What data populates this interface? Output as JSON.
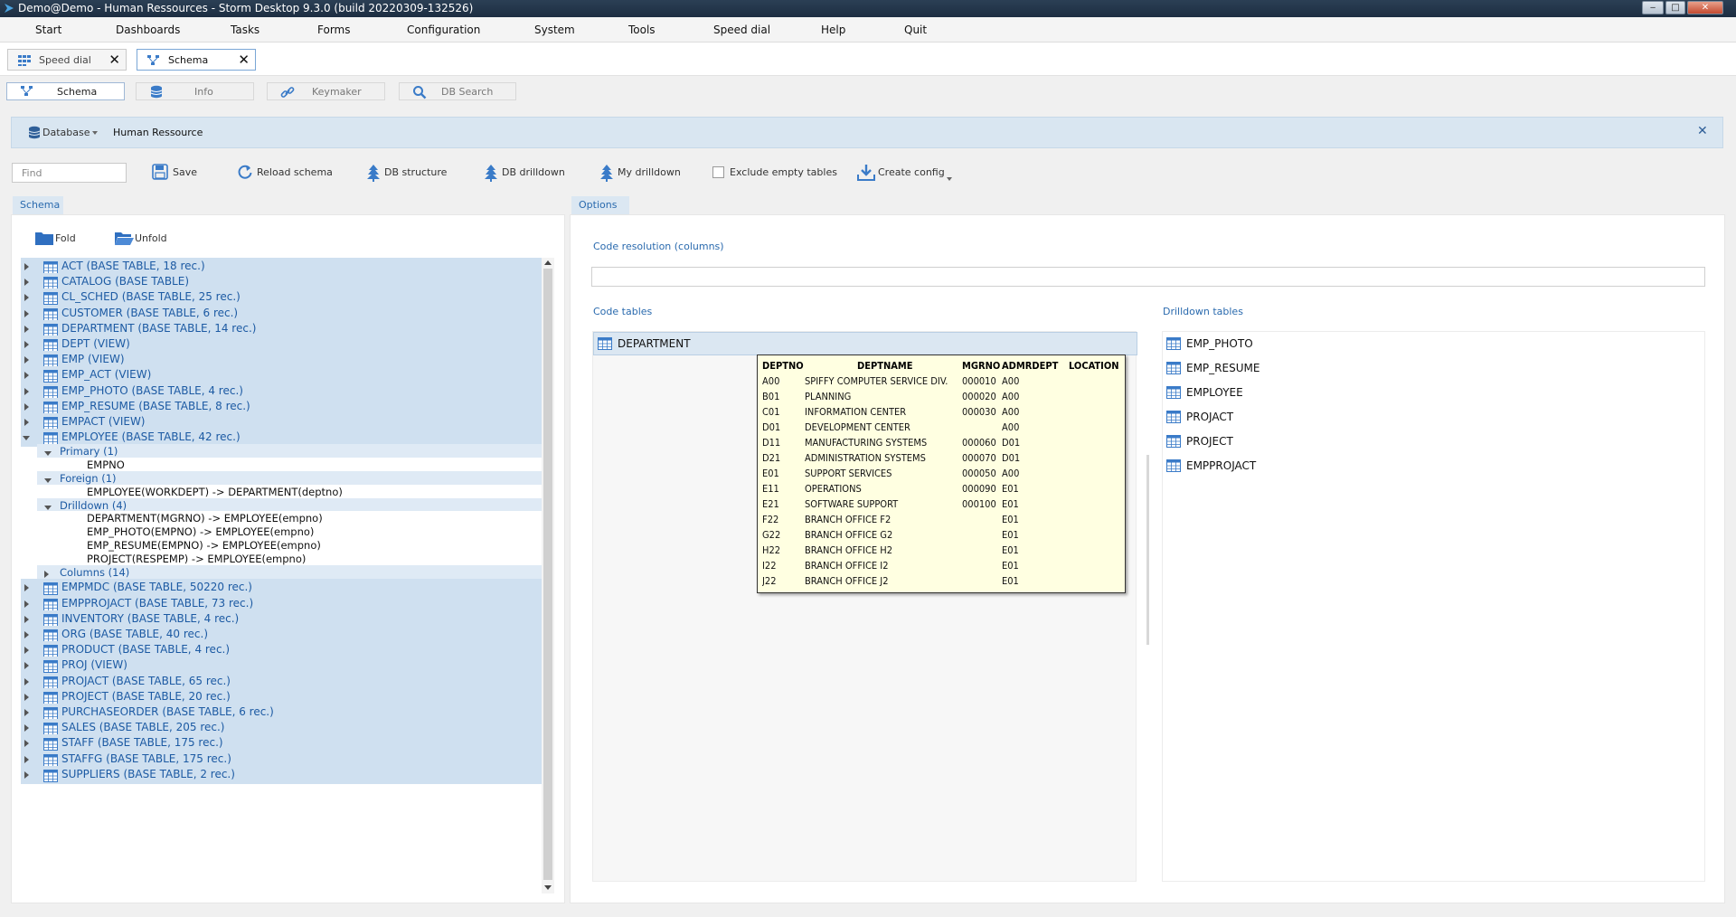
{
  "window": {
    "title": "Demo@Demo - Human Ressources -  Storm Desktop 9.3.0 (build 20220309-132526)",
    "minimize": "‒",
    "maximize": "□",
    "close": "✕"
  },
  "menu": [
    "Start",
    "Dashboards",
    "Tasks",
    "Forms",
    "Configuration",
    "System",
    "Tools",
    "Speed dial",
    "Help",
    "Quit"
  ],
  "doc_tabs": [
    {
      "label": "Speed dial",
      "icon": "grid-icon"
    },
    {
      "label": "Schema",
      "icon": "schema-icon"
    }
  ],
  "doc_tab_close": "✕",
  "sub_tabs": [
    {
      "label": "Schema",
      "icon": "schema-icon"
    },
    {
      "label": "Info",
      "icon": "database-icon"
    },
    {
      "label": "Keymaker",
      "icon": "link-icon"
    },
    {
      "label": "DB Search",
      "icon": "search-icon"
    }
  ],
  "breadcrumb": {
    "database_label": "Database",
    "current": "Human Ressource",
    "close": "✕"
  },
  "toolbar": {
    "find_placeholder": "Find",
    "save": "Save",
    "reload": "Reload schema",
    "db_structure": "DB structure",
    "db_drilldown": "DB drilldown",
    "my_drilldown": "My drilldown",
    "exclude_empty": "Exclude empty tables",
    "create_config": "Create config"
  },
  "left_panel": {
    "tab": "Schema",
    "fold": "Fold",
    "unfold": "Unfold",
    "tables_before": [
      "ACT (BASE TABLE, 18 rec.)",
      "CATALOG (BASE TABLE)",
      "CL_SCHED (BASE TABLE, 25 rec.)",
      "CUSTOMER (BASE TABLE, 6 rec.)",
      "DEPARTMENT (BASE TABLE, 14 rec.)",
      "DEPT (VIEW)",
      "EMP (VIEW)",
      "EMP_ACT (VIEW)",
      "EMP_PHOTO (BASE TABLE, 4 rec.)",
      "EMP_RESUME (BASE TABLE, 8 rec.)",
      "EMPACT (VIEW)"
    ],
    "expanded_table": "EMPLOYEE (BASE TABLE, 42 rec.)",
    "primary_label": "Primary (1)",
    "primary_items": [
      "EMPNO"
    ],
    "foreign_label": "Foreign (1)",
    "foreign_items": [
      "EMPLOYEE(WORKDEPT) -> DEPARTMENT(deptno)"
    ],
    "drilldown_label": "Drilldown (4)",
    "drilldown_items": [
      "DEPARTMENT(MGRNO) -> EMPLOYEE(empno)",
      "EMP_PHOTO(EMPNO) -> EMPLOYEE(empno)",
      "EMP_RESUME(EMPNO) -> EMPLOYEE(empno)",
      "PROJECT(RESPEMP) -> EMPLOYEE(empno)"
    ],
    "columns_label": "Columns (14)",
    "tables_after": [
      "EMPMDC (BASE TABLE, 50220 rec.)",
      "EMPPROJACT (BASE TABLE, 73 rec.)",
      "INVENTORY (BASE TABLE, 4 rec.)",
      "ORG (BASE TABLE, 40 rec.)",
      "PRODUCT (BASE TABLE, 4 rec.)",
      "PROJ (VIEW)",
      "PROJACT (BASE TABLE, 65 rec.)",
      "PROJECT (BASE TABLE, 20 rec.)",
      "PURCHASEORDER (BASE TABLE, 6 rec.)",
      "SALES (BASE TABLE, 205 rec.)",
      "STAFF (BASE TABLE, 175 rec.)",
      "STAFFG (BASE TABLE, 175 rec.)",
      "SUPPLIERS (BASE TABLE, 2 rec.)"
    ]
  },
  "right_panel": {
    "tab": "Options",
    "code_resolution_label": "Code resolution (columns)",
    "code_tables_label": "Code tables",
    "code_tables": [
      "DEPARTMENT"
    ],
    "drilldown_tables_label": "Drilldown tables",
    "drilldown_tables": [
      "EMP_PHOTO",
      "EMP_RESUME",
      "EMPLOYEE",
      "PROJACT",
      "PROJECT",
      "EMPPROJACT"
    ]
  },
  "tooltip": {
    "headers": [
      "DEPTNO",
      "DEPTNAME",
      "MGRNO",
      "ADMRDEPT",
      "LOCATION"
    ],
    "rows": [
      [
        "A00",
        "SPIFFY COMPUTER SERVICE DIV.",
        "000010",
        "A00",
        ""
      ],
      [
        "B01",
        "PLANNING",
        "000020",
        "A00",
        ""
      ],
      [
        "C01",
        "INFORMATION CENTER",
        "000030",
        "A00",
        ""
      ],
      [
        "D01",
        "DEVELOPMENT CENTER",
        "",
        "A00",
        ""
      ],
      [
        "D11",
        "MANUFACTURING SYSTEMS",
        "000060",
        "D01",
        ""
      ],
      [
        "D21",
        "ADMINISTRATION SYSTEMS",
        "000070",
        "D01",
        ""
      ],
      [
        "E01",
        "SUPPORT SERVICES",
        "000050",
        "A00",
        ""
      ],
      [
        "E11",
        "OPERATIONS",
        "000090",
        "E01",
        ""
      ],
      [
        "E21",
        "SOFTWARE SUPPORT",
        "000100",
        "E01",
        ""
      ],
      [
        "F22",
        "BRANCH OFFICE F2",
        "",
        "E01",
        ""
      ],
      [
        "G22",
        "BRANCH OFFICE G2",
        "",
        "E01",
        ""
      ],
      [
        "H22",
        "BRANCH OFFICE H2",
        "",
        "E01",
        ""
      ],
      [
        "I22",
        "BRANCH OFFICE I2",
        "",
        "E01",
        ""
      ],
      [
        "J22",
        "BRANCH OFFICE J2",
        "",
        "E01",
        ""
      ]
    ]
  },
  "colors": {
    "accent": "#2a6aae",
    "selection": "#cfe0f0",
    "tooltip_bg": "#ffffe1"
  }
}
